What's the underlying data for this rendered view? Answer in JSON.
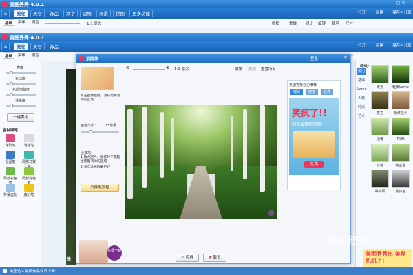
{
  "app": {
    "title": "美图秀秀 4.0.1"
  },
  "menu": {
    "tabs": [
      "美化",
      "美容",
      "饰品",
      "文字",
      "边框",
      "场景",
      "拼图",
      "更多功能"
    ]
  },
  "right_buttons": {
    "open": "打开",
    "new": "新建",
    "save": "保存与分享"
  },
  "subtabs": [
    "基础",
    "高级",
    "调色"
  ],
  "toolbar": {
    "original": "1:1 原大",
    "rotate": "旋转",
    "crop": "裁剪",
    "size": "尺寸",
    "undo": "撤销",
    "redo": "重做",
    "compare": "对比"
  },
  "left_panel": {
    "sliders": [
      "亮度",
      "对比度",
      "色彩饱和度",
      "清晰度"
    ],
    "one_key": "一键美化",
    "section": "各种画笔",
    "tools": [
      "涂鸦笔",
      "消除笔",
      "抠图笔",
      "局部马赛克",
      "局部彩色笔",
      "局部变色笔",
      "背景虚化",
      "魔幻笔"
    ]
  },
  "right_panel": {
    "title": "特效:",
    "categories": [
      "热门",
      "基础",
      "Lomo",
      "人像",
      "时尚",
      "艺术"
    ],
    "thumbs": [
      "柔光",
      "轻微Lomo",
      "复古",
      "粉红佳人",
      "淡雅",
      "HDR",
      "云端",
      "阿宝色",
      "哥特风",
      "黑白色"
    ]
  },
  "dialog": {
    "title": "消除笔",
    "tip_lines": [
      "点击图像左键，涂抹需要消除的区域"
    ],
    "brush_label": "画笔大小：",
    "brush_value": "15像素",
    "hint_title": "小技巧：",
    "hints": [
      "1.放大图片，涂抹时不要超出需要消除的区域",
      "2.多次涂抹效果更好"
    ],
    "tutorial": "消除笔教程",
    "toolbar": {
      "original": "1:1 原大",
      "undo": "撤销",
      "redo": "重做",
      "reset": "重置所有"
    },
    "apply": "应用",
    "cancel": "取消",
    "promo_panel": {
      "header": "美图秀秀强力推荐",
      "tabs": [
        "视频",
        "搜索",
        "软件"
      ],
      "ad_big": "笑疯了!!",
      "ad_sub": "超多爆笑短视频!",
      "ad_btn": "点我"
    },
    "badge": "免费下载",
    "login": "登录"
  },
  "status": {
    "text": "美图达人最新作品今日上新!"
  },
  "watermark": {
    "baidu": "Bai 经验",
    "promo": "美图秀秀出 美秋机机了!"
  },
  "colors": {
    "accent": "#1f6fc4",
    "bg": "#eaf1f8"
  }
}
